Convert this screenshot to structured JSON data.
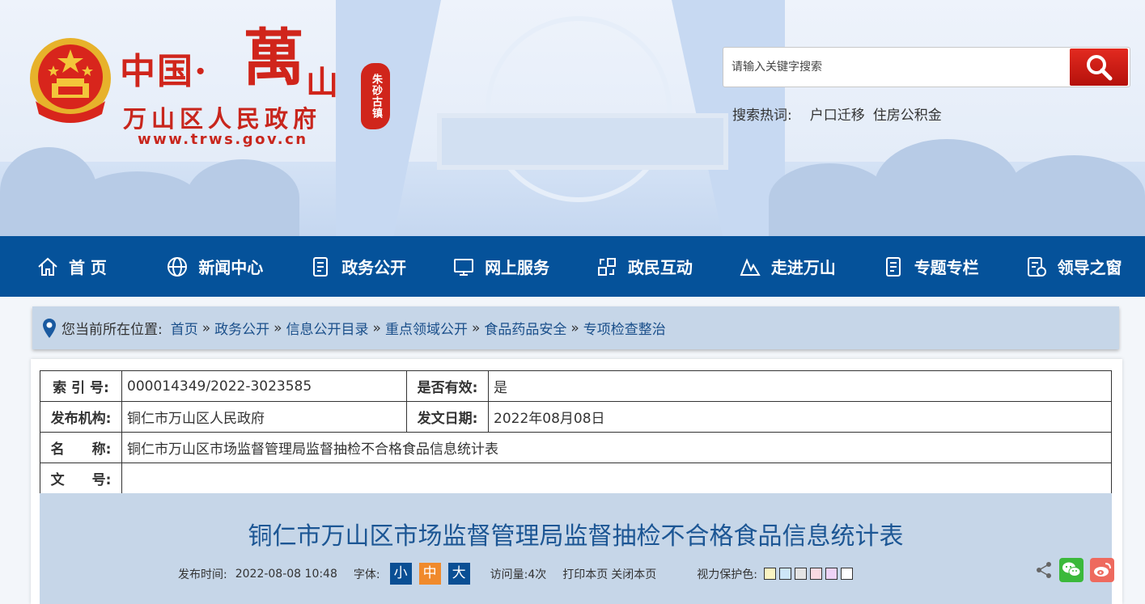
{
  "header": {
    "title_part1": "中国·",
    "title_part2": "萬",
    "title_part3": "山",
    "seal_text": "朱砂古镇",
    "gov_name": "万山区人民政府",
    "url": "www.trws.gov.cn"
  },
  "search": {
    "placeholder": "请输入关键字搜索",
    "hot_label": "搜索热词:",
    "hot_words": [
      "户口迁移",
      "住房公积金"
    ]
  },
  "nav": {
    "items": [
      {
        "label": "首 页",
        "icon": "home-icon"
      },
      {
        "label": "新闻中心",
        "icon": "globe-icon"
      },
      {
        "label": "政务公开",
        "icon": "document-icon"
      },
      {
        "label": "网上服务",
        "icon": "monitor-icon"
      },
      {
        "label": "政民互动",
        "icon": "exchange-icon"
      },
      {
        "label": "走进万山",
        "icon": "mountain-icon"
      },
      {
        "label": "专题专栏",
        "icon": "document-icon"
      },
      {
        "label": "领导之窗",
        "icon": "leader-doc-icon"
      }
    ]
  },
  "breadcrumb": {
    "label": "您当前所在位置:",
    "items": [
      "首页",
      "政务公开",
      "信息公开目录",
      "重点领域公开",
      "食品药品安全",
      "专项检查整治"
    ],
    "separator": "»"
  },
  "meta": {
    "index_label": "索 引 号:",
    "index_value": "000014349/2022-3023585",
    "valid_label": "是否有效:",
    "valid_value": "是",
    "org_label": "发布机构:",
    "org_value": "铜仁市万山区人民政府",
    "date_label": "发文日期:",
    "date_value": "2022年08月08日",
    "name_label": "名　　称:",
    "name_value": "铜仁市万山区市场监督管理局监督抽检不合格食品信息统计表",
    "docno_label": "文　　号:",
    "docno_value": ""
  },
  "article": {
    "title": "铜仁市万山区市场监督管理局监督抽检不合格食品信息统计表",
    "publish_label": "发布时间:",
    "publish_time": "2022-08-08 10:48",
    "font_label": "字体:",
    "font_small": "小",
    "font_medium": "中",
    "font_large": "大",
    "visits": "访问量:4次",
    "print_label": "打印本页",
    "close_label": "关闭本页",
    "vision_label": "视力保护色:",
    "swatches": [
      "#fbf4c2",
      "#cde6f7",
      "#e4e4e4",
      "#f9d9e1",
      "#eed3f7",
      "#ffffff"
    ]
  },
  "colors": {
    "nav_bg": "#05529a",
    "brand_red": "#d0251b",
    "crumb_bg": "#c6d6e8",
    "title_blue": "#1c5694"
  }
}
